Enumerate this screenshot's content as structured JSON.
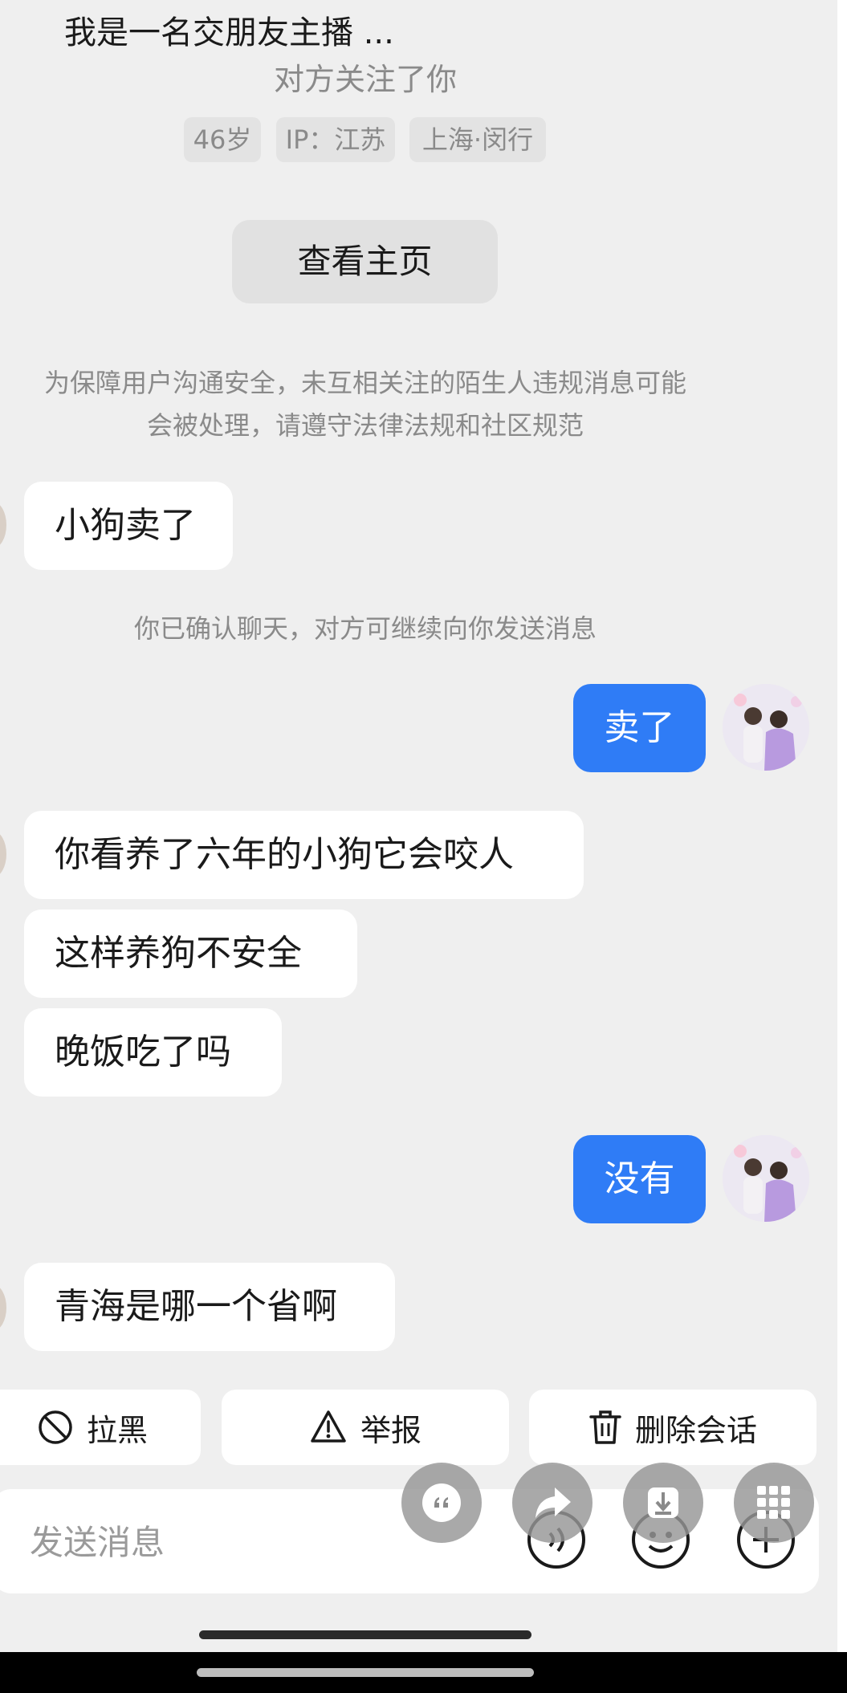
{
  "header": {
    "name": "我是一名交朋友主播 ...",
    "follow_note": "对方关注了你",
    "tags": [
      "46岁",
      "IP：江苏",
      "上海·闵行"
    ],
    "view_home": "查看主页"
  },
  "notices": {
    "safety_line1": "为保障用户沟通安全，未互相关注的陌生人违规消息可能",
    "safety_line2": "会被处理，请遵守法律法规和社区规范",
    "confirm": "你已确认聊天，对方可继续向你发送消息"
  },
  "messages": [
    {
      "from": "other",
      "text": "小狗卖了"
    },
    {
      "from": "self",
      "text": "卖了"
    },
    {
      "from": "other",
      "text": "你看养了六年的小狗它会咬人"
    },
    {
      "from": "other",
      "text": "这样养狗不安全"
    },
    {
      "from": "other",
      "text": "晚饭吃了吗"
    },
    {
      "from": "self",
      "text": "没有"
    },
    {
      "from": "other",
      "text": "青海是哪一个省啊"
    }
  ],
  "actions": {
    "block": "拉黑",
    "report": "举报",
    "delete_chat": "删除会话"
  },
  "input": {
    "placeholder": "发送消息",
    "value": ""
  },
  "icons": {
    "block": "block-icon",
    "report": "warning-icon",
    "delete": "trash-icon",
    "voice": "voice-icon",
    "emoji": "emoji-icon",
    "add": "add-icon",
    "quote": "quote-icon",
    "forward": "forward-icon",
    "save": "save-icon",
    "more": "grid-icon"
  },
  "colors": {
    "outgoing_bubble": "#2f7cf6",
    "incoming_bubble": "#ffffff",
    "background": "#efefef"
  }
}
